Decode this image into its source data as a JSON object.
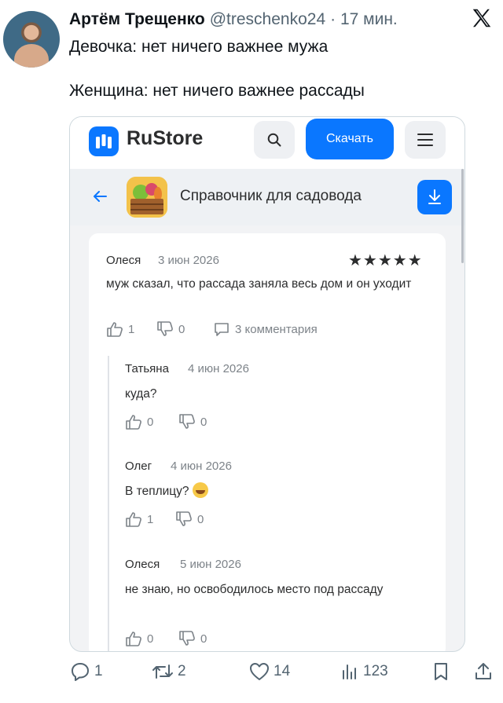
{
  "tweet": {
    "author_name": "Артём Трещенко",
    "handle": "@treschenko24",
    "time": "· 17 мин.",
    "text_line1": "Девочка: нет ничего важнее мужа",
    "text_line2": "Женщина: нет ничего важнее рассады"
  },
  "rustore": {
    "logo_text": "RuStore",
    "download_label": "Скачать",
    "app_title": "Справочник для садовода",
    "review": {
      "author": "Олеся",
      "date": "3 июн 2026",
      "stars": "★★★★★",
      "rating": 5,
      "text": "муж сказал, что рассада заняла весь дом и он уходит",
      "likes": "1",
      "dislikes": "0",
      "comments": "3 комментария"
    },
    "replies": [
      {
        "author": "Татьяна",
        "date": "4 июн 2026",
        "text": "куда?",
        "likes": "0",
        "dislikes": "0"
      },
      {
        "author": "Олег",
        "date": "4 июн 2026",
        "text": "В теплицу?",
        "emoji": "grinning-sweat-emoji",
        "likes": "1",
        "dislikes": "0"
      },
      {
        "author": "Олеся",
        "date": "5 июн 2026",
        "text": "не знаю, но освободилось место под рассаду",
        "likes": "0",
        "dislikes": "0"
      }
    ]
  },
  "actions": {
    "replies": "1",
    "retweets": "2",
    "likes": "14",
    "views": "123"
  },
  "colors": {
    "accent": "#0a77ff",
    "muted": "#536471"
  }
}
